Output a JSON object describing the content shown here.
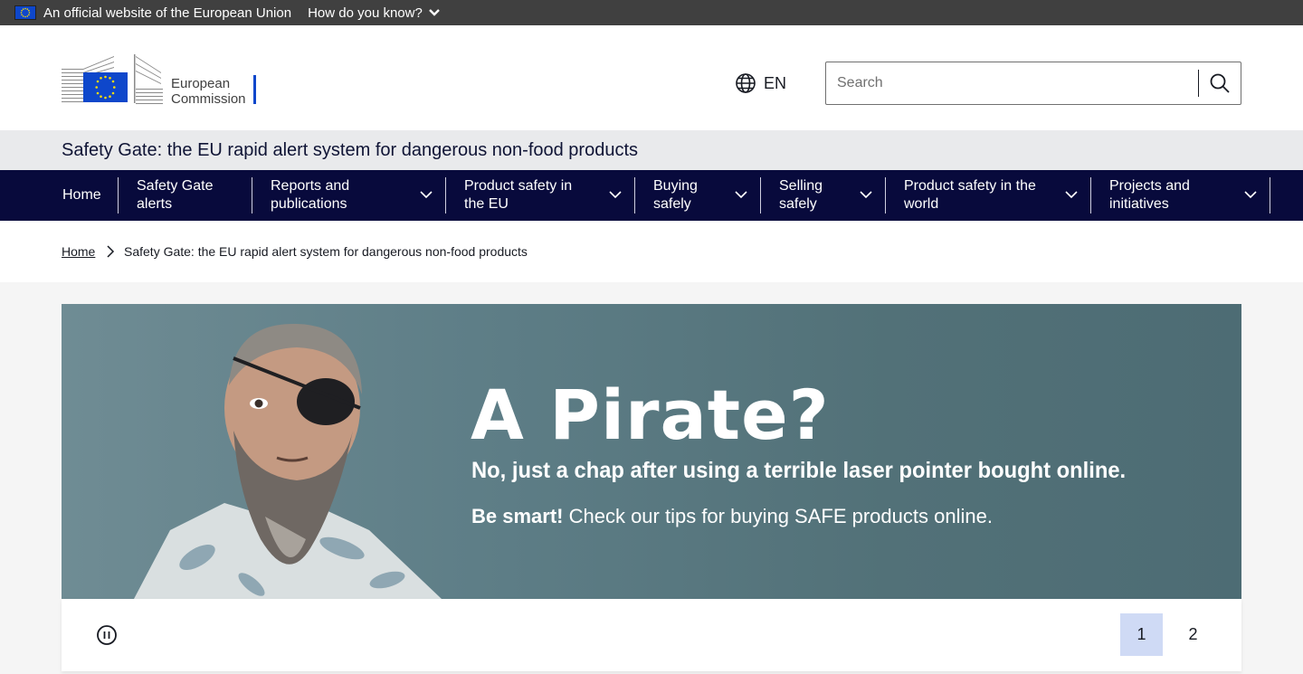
{
  "eu_bar": {
    "official_text": "An official website of the European Union",
    "how_know": "How do you know?"
  },
  "header": {
    "logo_line1": "European",
    "logo_line2": "Commission",
    "language": "EN",
    "search_placeholder": "Search"
  },
  "site_name": "Safety Gate: the EU rapid alert system for dangerous non-food products",
  "nav": {
    "items": [
      {
        "line1": "Home",
        "line2": ""
      },
      {
        "line1": "Safety Gate",
        "line2": "alerts"
      },
      {
        "line1": "Reports and",
        "line2": "publications"
      },
      {
        "line1": "Product safety in",
        "line2": "the EU"
      },
      {
        "line1": "Buying",
        "line2": "safely"
      },
      {
        "line1": "Selling",
        "line2": "safely"
      },
      {
        "line1": "Product safety in the",
        "line2": "world"
      },
      {
        "line1": "Projects and",
        "line2": "initiatives"
      }
    ]
  },
  "breadcrumb": {
    "home": "Home",
    "current": "Safety Gate: the EU rapid alert system for dangerous non-food products"
  },
  "banner": {
    "headline": "A Pirate?",
    "subline": "No, just a chap after using a terrible laser pointer bought online.",
    "cta_bold": "Be smart!",
    "cta_rest": " Check our tips for buying SAFE products online."
  },
  "carousel": {
    "pages": [
      "1",
      "2"
    ],
    "active_page": "1"
  },
  "colors": {
    "nav_bg": "#080a3c",
    "eu_bar_bg": "#404040",
    "eu_blue": "#0e47cb",
    "active_page_bg": "#cfdaf5"
  }
}
